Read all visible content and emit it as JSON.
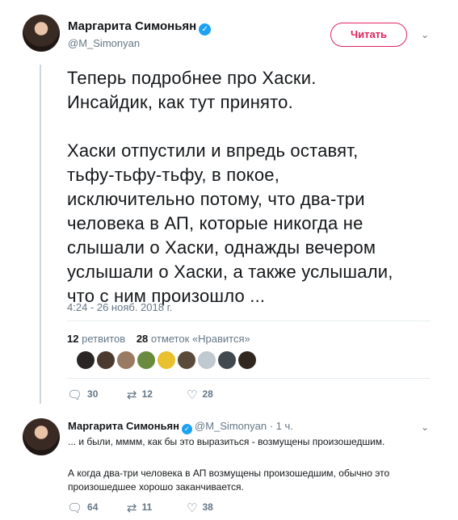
{
  "tweet": {
    "author_name": "Маргарита Симоньян",
    "author_handle": "@M_Simonyan",
    "follow_label": "Читать",
    "caret_icon": "chevron-down-icon",
    "verified_icon": "verified-badge-icon",
    "paragraphs": [
      [
        "Теперь подробнее про Хаски.",
        "Инсайдик, как тут принято."
      ],
      [
        "Хаски отпустили и впредь оставят,",
        "тьфу-тьфу-тьфу, в покое,",
        "исключительно потому, что два-три",
        "человека в АП, которые никогда не",
        "слышали о Хаски, однажды вечером",
        "услышали о Хаски, а также услышали,",
        "что с ним произошло ..."
      ]
    ],
    "timestamp": "4:24 - 26 нояб. 2018 г.",
    "retweets_count": "12",
    "retweets_label": "ретвитов",
    "likes_count": "28",
    "likes_label": "отметок «Нравится»",
    "liker_colors": [
      "#2b2424",
      "#4a3a30",
      "#9a7a60",
      "#6a8a40",
      "#e8c030",
      "#5a4a3a",
      "#c0c8d0",
      "#404850",
      "#302820"
    ],
    "actions": {
      "reply_count": "30",
      "retweet_count": "12",
      "like_count": "28",
      "reply_icon": "reply-icon",
      "retweet_icon": "retweet-icon",
      "like_icon": "heart-icon"
    }
  },
  "reply": {
    "author_name": "Маргарита Симоньян",
    "author_handle": "@M_Simonyan",
    "time": "· 1 ч.",
    "line1": "... и были, мммм, как бы это выразиться - возмущены произошедшим.",
    "line2": "А когда два-три человека в АП возмущены произошедшим, обычно это произошедшее хорошо заканчивается.",
    "actions": {
      "reply_count": "64",
      "retweet_count": "11",
      "like_count": "38"
    }
  },
  "colors": {
    "accent_follow": "#e0245e",
    "verified": "#1da1f2",
    "muted_text": "#657786"
  }
}
